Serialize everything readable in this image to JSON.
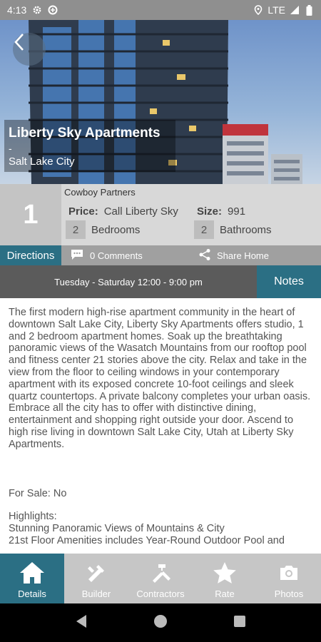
{
  "status_bar": {
    "time": "4:13",
    "network": "LTE",
    "icons": [
      "gear-icon",
      "data-saver-icon",
      "location-icon",
      "signal-icon",
      "battery-icon"
    ]
  },
  "hero": {
    "title": "Liberty Sky Apartments",
    "separator": "-",
    "city": "Salt Lake City",
    "back_icon": "chevron-left-icon"
  },
  "info": {
    "number": "1",
    "builder": "Cowboy Partners",
    "price_label": "Price:",
    "price_value": "Call Liberty Sky",
    "size_label": "Size:",
    "size_value": "991",
    "bedrooms_count": "2",
    "bedrooms_label": "Bedrooms",
    "bathrooms_count": "2",
    "bathrooms_label": "Bathrooms",
    "directions_label": "Directions",
    "comments_label": "0 Comments",
    "share_label": "Share Home"
  },
  "hours": {
    "text": "Tuesday - Saturday 12:00 - 9:00 pm",
    "notes_label": "Notes"
  },
  "description": {
    "paragraph": "The first modern high-rise apartment community in the heart of downtown Salt Lake City, Liberty Sky Apartments offers studio, 1 and 2 bedroom apartment homes. Soak up the breathtaking panoramic views of the Wasatch Mountains from our rooftop pool and fitness center 21 stories above the city. Relax and take in the view from the floor to ceiling windows in your contemporary apartment with its exposed concrete 10-foot ceilings and sleek quartz countertops. A private balcony completes your urban oasis. Embrace all the city has to offer with distinctive dining, entertainment and shopping right outside your door. Ascend to high rise living in downtown Salt Lake City, Utah at Liberty Sky Apartments.",
    "for_sale": "For Sale: No",
    "highlights_title": "Highlights:",
    "highlight_1": "Stunning Panoramic Views of Mountains & City",
    "highlight_2": "21st Floor Amenities includes Year-Round Outdoor Pool and"
  },
  "bottom_nav": {
    "items": [
      {
        "label": "Details",
        "icon": "home-icon"
      },
      {
        "label": "Builder",
        "icon": "tools-icon"
      },
      {
        "label": "Contractors",
        "icon": "hammer-wrench-icon"
      },
      {
        "label": "Rate",
        "icon": "star-icon"
      },
      {
        "label": "Photos",
        "icon": "camera-icon"
      }
    ]
  },
  "colors": {
    "accent": "#2b6f84",
    "panel": "#d8d8d8",
    "hours_bar": "#5b5b5b",
    "nav_bg": "#c6c6c6"
  }
}
